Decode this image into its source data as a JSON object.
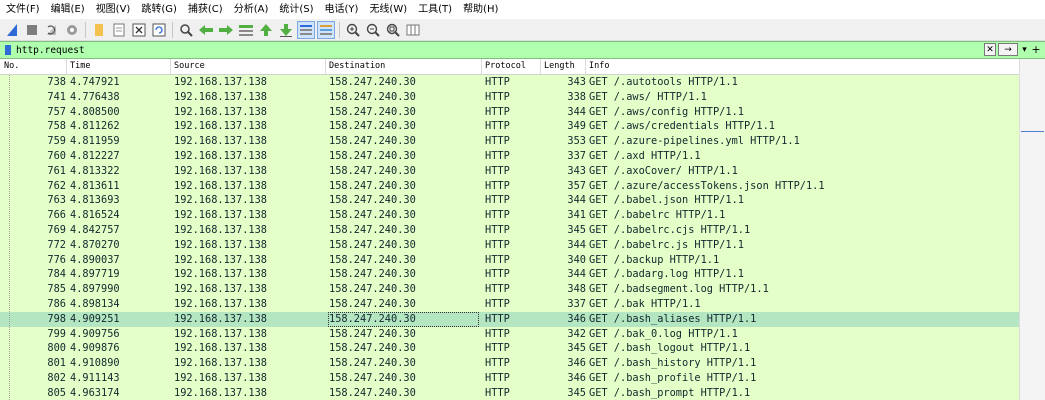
{
  "menu": [
    "文件(F)",
    "编辑(E)",
    "视图(V)",
    "跳转(G)",
    "捕获(C)",
    "分析(A)",
    "统计(S)",
    "电话(Y)",
    "无线(W)",
    "工具(T)",
    "帮助(H)"
  ],
  "toolbar_icons": [
    "shark-fin-icon",
    "stop-icon",
    "restart-icon",
    "options-icon",
    "open-file-icon",
    "save-file-icon",
    "close-file-icon",
    "reload-icon",
    "find-packet-icon",
    "go-back-icon",
    "go-forward-icon",
    "go-to-packet-icon",
    "go-first-icon",
    "go-last-icon",
    "autoscroll-icon",
    "colorize-icon",
    "zoom-in-icon",
    "zoom-out-icon",
    "zoom-normal-icon",
    "resize-columns-icon"
  ],
  "filter": {
    "value": "http.request",
    "clear_label": "✕",
    "apply_label": "→",
    "dropdown_label": "▾",
    "add_label": "+"
  },
  "columns": [
    "No.",
    "Time",
    "Source",
    "Destination",
    "Protocol",
    "Length",
    "Info"
  ],
  "colors": {
    "row_bg": "#e4ffc7",
    "selected_bg": "#b4e6c2",
    "filter_bg": "#afffaf"
  },
  "packets": [
    {
      "no": "738",
      "time": "4.747921",
      "src": "192.168.137.138",
      "dst": "158.247.240.30",
      "proto": "HTTP",
      "len": "343",
      "info": "GET /.autotools HTTP/1.1"
    },
    {
      "no": "741",
      "time": "4.776438",
      "src": "192.168.137.138",
      "dst": "158.247.240.30",
      "proto": "HTTP",
      "len": "338",
      "info": "GET /.aws/ HTTP/1.1"
    },
    {
      "no": "757",
      "time": "4.808500",
      "src": "192.168.137.138",
      "dst": "158.247.240.30",
      "proto": "HTTP",
      "len": "344",
      "info": "GET /.aws/config HTTP/1.1"
    },
    {
      "no": "758",
      "time": "4.811262",
      "src": "192.168.137.138",
      "dst": "158.247.240.30",
      "proto": "HTTP",
      "len": "349",
      "info": "GET /.aws/credentials HTTP/1.1"
    },
    {
      "no": "759",
      "time": "4.811959",
      "src": "192.168.137.138",
      "dst": "158.247.240.30",
      "proto": "HTTP",
      "len": "353",
      "info": "GET /.azure-pipelines.yml HTTP/1.1"
    },
    {
      "no": "760",
      "time": "4.812227",
      "src": "192.168.137.138",
      "dst": "158.247.240.30",
      "proto": "HTTP",
      "len": "337",
      "info": "GET /.axd HTTP/1.1"
    },
    {
      "no": "761",
      "time": "4.813322",
      "src": "192.168.137.138",
      "dst": "158.247.240.30",
      "proto": "HTTP",
      "len": "343",
      "info": "GET /.axoCover/ HTTP/1.1"
    },
    {
      "no": "762",
      "time": "4.813611",
      "src": "192.168.137.138",
      "dst": "158.247.240.30",
      "proto": "HTTP",
      "len": "357",
      "info": "GET /.azure/accessTokens.json HTTP/1.1"
    },
    {
      "no": "763",
      "time": "4.813693",
      "src": "192.168.137.138",
      "dst": "158.247.240.30",
      "proto": "HTTP",
      "len": "344",
      "info": "GET /.babel.json HTTP/1.1"
    },
    {
      "no": "766",
      "time": "4.816524",
      "src": "192.168.137.138",
      "dst": "158.247.240.30",
      "proto": "HTTP",
      "len": "341",
      "info": "GET /.babelrc HTTP/1.1"
    },
    {
      "no": "769",
      "time": "4.842757",
      "src": "192.168.137.138",
      "dst": "158.247.240.30",
      "proto": "HTTP",
      "len": "345",
      "info": "GET /.babelrc.cjs HTTP/1.1"
    },
    {
      "no": "772",
      "time": "4.870270",
      "src": "192.168.137.138",
      "dst": "158.247.240.30",
      "proto": "HTTP",
      "len": "344",
      "info": "GET /.babelrc.js HTTP/1.1"
    },
    {
      "no": "776",
      "time": "4.890037",
      "src": "192.168.137.138",
      "dst": "158.247.240.30",
      "proto": "HTTP",
      "len": "340",
      "info": "GET /.backup HTTP/1.1"
    },
    {
      "no": "784",
      "time": "4.897719",
      "src": "192.168.137.138",
      "dst": "158.247.240.30",
      "proto": "HTTP",
      "len": "344",
      "info": "GET /.badarg.log HTTP/1.1"
    },
    {
      "no": "785",
      "time": "4.897990",
      "src": "192.168.137.138",
      "dst": "158.247.240.30",
      "proto": "HTTP",
      "len": "348",
      "info": "GET /.badsegment.log HTTP/1.1"
    },
    {
      "no": "786",
      "time": "4.898134",
      "src": "192.168.137.138",
      "dst": "158.247.240.30",
      "proto": "HTTP",
      "len": "337",
      "info": "GET /.bak HTTP/1.1"
    },
    {
      "no": "798",
      "time": "4.909251",
      "src": "192.168.137.138",
      "dst": "158.247.240.30",
      "proto": "HTTP",
      "len": "346",
      "info": "GET /.bash_aliases HTTP/1.1",
      "selected": true
    },
    {
      "no": "799",
      "time": "4.909756",
      "src": "192.168.137.138",
      "dst": "158.247.240.30",
      "proto": "HTTP",
      "len": "342",
      "info": "GET /.bak_0.log HTTP/1.1"
    },
    {
      "no": "800",
      "time": "4.909876",
      "src": "192.168.137.138",
      "dst": "158.247.240.30",
      "proto": "HTTP",
      "len": "345",
      "info": "GET /.bash_logout HTTP/1.1"
    },
    {
      "no": "801",
      "time": "4.910890",
      "src": "192.168.137.138",
      "dst": "158.247.240.30",
      "proto": "HTTP",
      "len": "346",
      "info": "GET /.bash_history HTTP/1.1"
    },
    {
      "no": "802",
      "time": "4.911143",
      "src": "192.168.137.138",
      "dst": "158.247.240.30",
      "proto": "HTTP",
      "len": "346",
      "info": "GET /.bash_profile HTTP/1.1"
    },
    {
      "no": "805",
      "time": "4.963174",
      "src": "192.168.137.138",
      "dst": "158.247.240.30",
      "proto": "HTTP",
      "len": "345",
      "info": "GET /.bash_prompt HTTP/1.1"
    }
  ]
}
